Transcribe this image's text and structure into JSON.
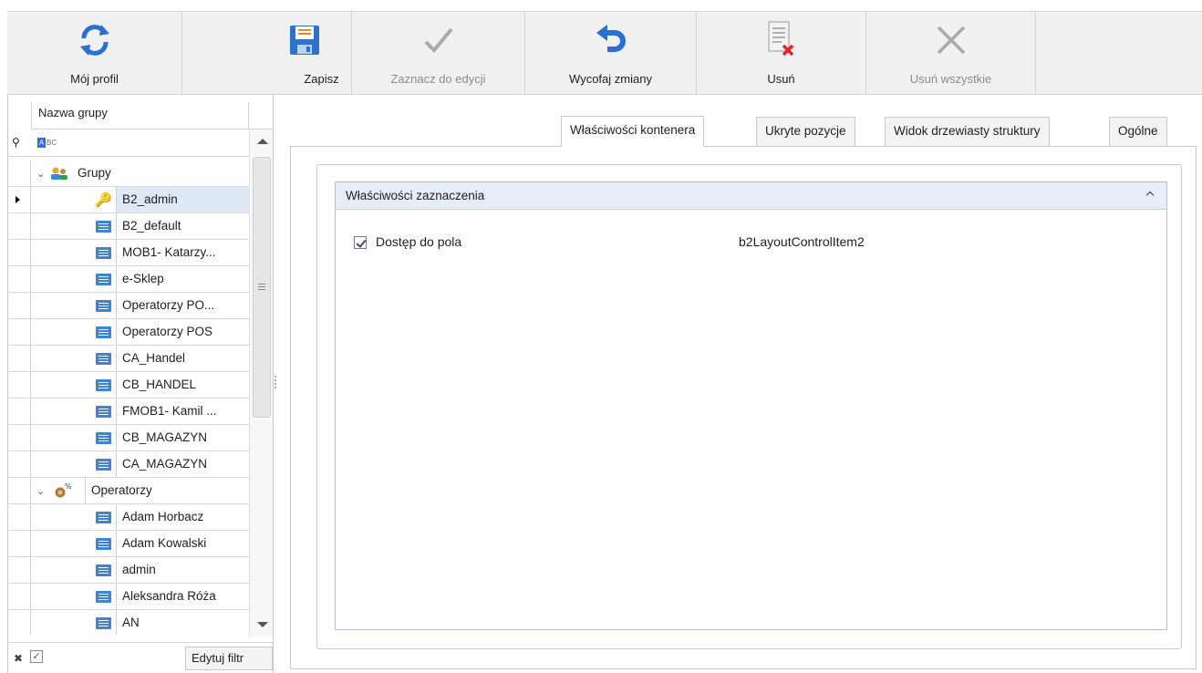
{
  "toolbar": {
    "buttons": [
      {
        "label": "Mój profil",
        "icon": "refresh-icon",
        "enabled": true
      },
      {
        "label": "Zapisz",
        "icon": "save-icon",
        "enabled": true
      },
      {
        "label": "Zaznacz do edycji",
        "icon": "check-icon",
        "enabled": false
      },
      {
        "label": "Wycofaj zmiany",
        "icon": "undo-icon",
        "enabled": true
      },
      {
        "label": "Usuń",
        "icon": "delete-document-icon",
        "enabled": true
      },
      {
        "label": "Usuń wszystkie",
        "icon": "close-icon",
        "enabled": false
      }
    ]
  },
  "grid": {
    "column_header": "Nazwa grupy",
    "filter_placeholder_icon": "abc-filter-icon",
    "tree": [
      {
        "label": "Grupy",
        "type": "group",
        "level": 0,
        "expanded": true,
        "icon": "users-group-icon"
      },
      {
        "label": "B2_admin",
        "type": "item",
        "level": 1,
        "icon": "key-icon",
        "selected": true
      },
      {
        "label": "B2_default",
        "type": "item",
        "level": 1,
        "icon": "list-item-icon"
      },
      {
        "label": "MOB1- Katarzy...",
        "type": "item",
        "level": 1,
        "icon": "list-item-icon"
      },
      {
        "label": "e-Sklep",
        "type": "item",
        "level": 1,
        "icon": "list-item-icon"
      },
      {
        "label": "Operatorzy PO...",
        "type": "item",
        "level": 1,
        "icon": "list-item-icon"
      },
      {
        "label": "Operatorzy POS",
        "type": "item",
        "level": 1,
        "icon": "list-item-icon"
      },
      {
        "label": "CA_Handel",
        "type": "item",
        "level": 1,
        "icon": "list-item-icon"
      },
      {
        "label": "CB_HANDEL",
        "type": "item",
        "level": 1,
        "icon": "list-item-icon"
      },
      {
        "label": "FMOB1- Kamil ...",
        "type": "item",
        "level": 1,
        "icon": "list-item-icon"
      },
      {
        "label": "CB_MAGAZYN",
        "type": "item",
        "level": 1,
        "icon": "list-item-icon"
      },
      {
        "label": "CA_MAGAZYN",
        "type": "item",
        "level": 1,
        "icon": "list-item-icon"
      },
      {
        "label": "Operatorzy",
        "type": "group",
        "level": 0,
        "expanded": true,
        "icon": "operators-icon"
      },
      {
        "label": "Adam Horbacz",
        "type": "item",
        "level": 1,
        "icon": "list-item-icon"
      },
      {
        "label": "Adam Kowalski",
        "type": "item",
        "level": 1,
        "icon": "list-item-icon"
      },
      {
        "label": "admin",
        "type": "item",
        "level": 1,
        "icon": "list-item-icon"
      },
      {
        "label": "Aleksandra Róża",
        "type": "item",
        "level": 1,
        "icon": "list-item-icon"
      },
      {
        "label": "AN",
        "type": "item",
        "level": 1,
        "icon": "list-item-icon"
      }
    ],
    "footer": {
      "edit_filter_label": "Edytuj filtr",
      "filter_enabled": true
    }
  },
  "tabs": [
    {
      "label": "Właściwości kontenera",
      "active": true
    },
    {
      "label": "Ukryte pozycje",
      "active": false
    },
    {
      "label": "Widok drzewiasty struktury",
      "active": false
    },
    {
      "label": "Ogólne",
      "active": false
    }
  ],
  "properties": {
    "group_title": "Właściwości zaznaczenia",
    "checkbox_label": "Dostęp do pola",
    "checkbox_checked": true,
    "field_value": "b2LayoutControlItem2"
  }
}
